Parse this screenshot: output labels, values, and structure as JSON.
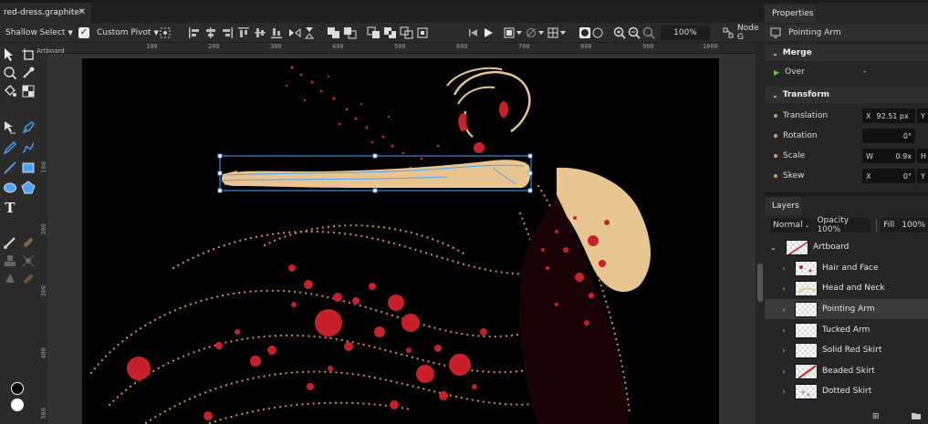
{
  "document": {
    "tab_title": "red-dress.graphite*",
    "close": "✕"
  },
  "toolbar": {
    "select_mode": "Shallow Select",
    "pivot_checked": true,
    "pivot_label": "Custom Pivot",
    "zoom": "100%",
    "node_graph": "Node G"
  },
  "ruler": {
    "h_ticks": [
      "100",
      "200",
      "300",
      "400",
      "500",
      "600",
      "700",
      "800",
      "900",
      "1000"
    ],
    "v_ticks": [
      "100",
      "200",
      "300",
      "400",
      "500"
    ]
  },
  "canvas": {
    "artboard_label": "Artboard"
  },
  "properties": {
    "tab": "Properties",
    "layer_name": "Pointing Arm",
    "merge": {
      "title": "Merge",
      "blend_label": "Over",
      "blend_value": "-"
    },
    "transform": {
      "title": "Transform",
      "translation_label": "Translation",
      "translation_x_axis": "X",
      "translation_x": "92.51 px",
      "translation_y_axis": "Y",
      "rotation_label": "Rotation",
      "rotation_value": "0°",
      "scale_label": "Scale",
      "scale_w_axis": "W",
      "scale_w": "0.9x",
      "scale_h_axis": "H",
      "skew_label": "Skew",
      "skew_x_axis": "X",
      "skew_x": "0°",
      "skew_y_axis": "Y"
    }
  },
  "layers_panel": {
    "tab": "Layers",
    "blend_mode": "Normal",
    "opacity": "Opacity 100%",
    "fill": "Fill",
    "fill_value": "100%",
    "root": "Artboard",
    "items": [
      {
        "name": "Hair and Face"
      },
      {
        "name": "Head and Neck"
      },
      {
        "name": "Pointing Arm",
        "selected": true
      },
      {
        "name": "Tucked Arm"
      },
      {
        "name": "Solid Red Skirt"
      },
      {
        "name": "Beaded Skirt"
      },
      {
        "name": "Dotted Skirt"
      }
    ]
  },
  "colors": {
    "accent": "#4aa3ff",
    "selected_row": "#3a3a3a",
    "dress_red": "#c8202a",
    "skin": "#e8c591",
    "beads": "#d9865a"
  }
}
